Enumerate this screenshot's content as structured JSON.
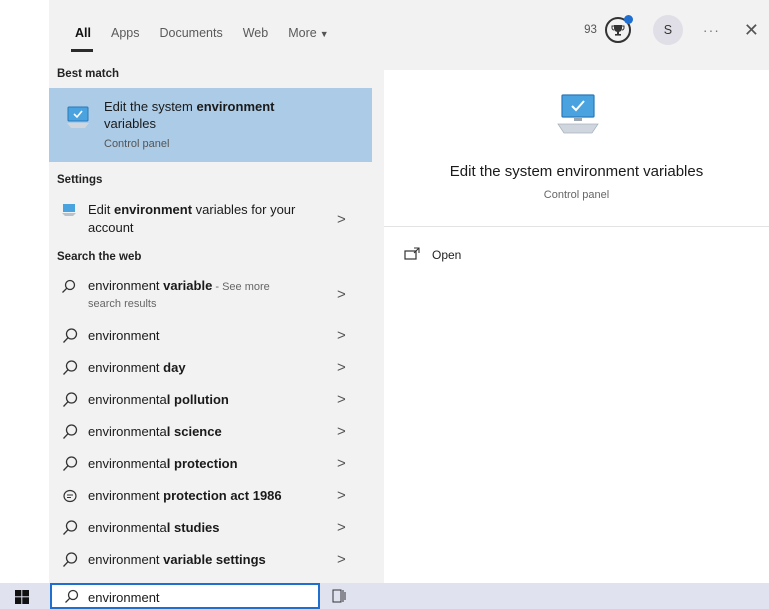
{
  "tabs": [
    {
      "label": "All",
      "active": true
    },
    {
      "label": "Apps"
    },
    {
      "label": "Documents"
    },
    {
      "label": "Web"
    },
    {
      "label": "More",
      "caret": "▼"
    }
  ],
  "topright": {
    "points": "93",
    "avatar": "S",
    "more": "···",
    "close": "✕"
  },
  "sections": {
    "best_match": "Best match",
    "settings": "Settings",
    "search_web": "Search the web"
  },
  "best_match": {
    "title_plain": "Edit the system ",
    "title_bold": "environment",
    "title_end": "variables",
    "subtitle": "Control panel"
  },
  "setting_item": {
    "pre": "Edit ",
    "bold": "environment",
    "post": " variables for your account"
  },
  "web_main": {
    "plain": "environment ",
    "bold": "variable",
    "see": " - See more",
    "sub": "search results"
  },
  "web_items": [
    {
      "plain": "environment",
      "bold": "",
      "icon": "search"
    },
    {
      "plain": "environment ",
      "bold": "day",
      "icon": "search"
    },
    {
      "plain": "environmenta",
      "bold": "l pollution",
      "icon": "search"
    },
    {
      "plain": "environmenta",
      "bold": "l science",
      "icon": "search"
    },
    {
      "plain": "environmenta",
      "bold": "l protection",
      "icon": "search"
    },
    {
      "plain": "environment ",
      "bold": "protection act 1986",
      "icon": "chat"
    },
    {
      "plain": "environmenta",
      "bold": "l studies",
      "icon": "search"
    },
    {
      "plain": "environment ",
      "bold": "variable settings",
      "icon": "search"
    }
  ],
  "preview": {
    "title": "Edit the system environment variables",
    "subtitle": "Control panel",
    "open": "Open"
  },
  "search": {
    "value": "environment"
  },
  "chevron": ">"
}
